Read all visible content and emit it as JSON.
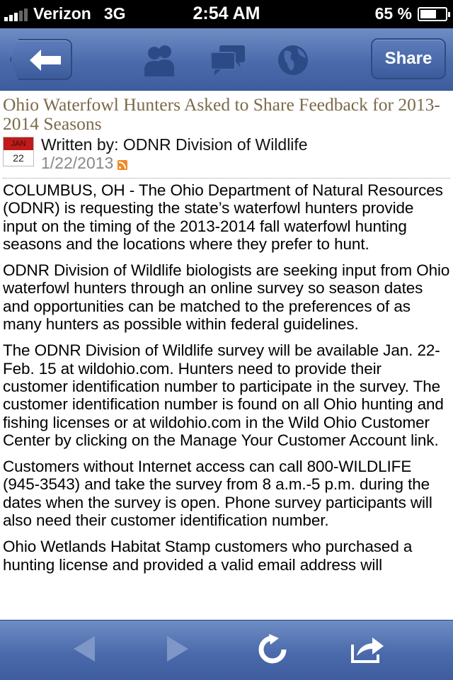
{
  "status_bar": {
    "carrier": "Verizon",
    "network": "3G",
    "time": "2:54 AM",
    "battery_text": "65 %",
    "battery_level": 0.65,
    "signal_bars": 3
  },
  "nav": {
    "back_icon": "back-arrow-icon",
    "icons": [
      "people-icon",
      "chat-bubbles-icon",
      "globe-icon"
    ],
    "share_label": "Share",
    "accent": "#4a6aab"
  },
  "article": {
    "title": "Ohio Waterfowl Hunters Asked to Share Feedback for 2013-2014 Seasons",
    "calendar_month": "JAN",
    "calendar_day": "22",
    "author": "Written by: ODNR Division of Wildlife",
    "date": "1/22/2013",
    "paragraphs": [
      "COLUMBUS, OH - The Ohio Department of Natural Resources (ODNR) is requesting the state’s waterfowl hunters provide input on the timing of the 2013-2014 fall waterfowl hunting seasons and the locations where they prefer to hunt.",
      "ODNR Division of Wildlife biologists are seeking input from Ohio waterfowl hunters through an online survey so season dates and opportunities can be matched to the preferences of as many hunters as possible within federal guidelines.",
      "The ODNR Division of Wildlife survey will be available Jan. 22-Feb. 15 at wildohio.com. Hunters need to provide their customer identification number to participate in the survey. The customer identification number is found on all Ohio hunting and fishing licenses or at wildohio.com in the Wild Ohio Customer Center by clicking on the Manage Your Customer Account link.",
      "Customers without Internet access can call 800-WILDLIFE (945-3543) and take the survey from 8 a.m.-5 p.m. during the dates when the survey is open. Phone survey participants will also need their customer identification number.",
      "Ohio Wetlands Habitat Stamp customers who purchased a hunting license and provided a valid email address will"
    ]
  },
  "toolbar": {
    "icons": [
      "back-nav-icon",
      "forward-nav-icon",
      "refresh-icon",
      "share-action-icon"
    ]
  }
}
